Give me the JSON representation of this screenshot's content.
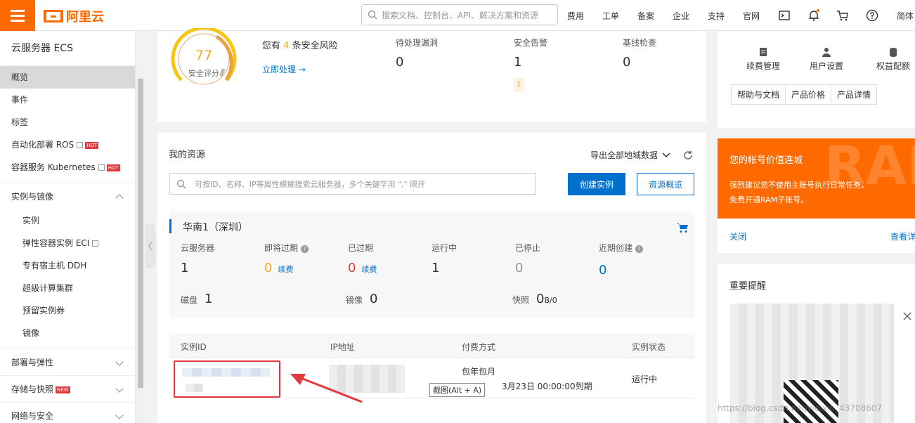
{
  "topbar": {
    "logo_text": "阿里云",
    "search_placeholder": "搜索文档、控制台、API、解决方案和资源",
    "nav_items": [
      "费用",
      "工单",
      "备案",
      "企业",
      "支持",
      "官网"
    ],
    "lang": "简体",
    "accent_color": "#ff6a00"
  },
  "sidebar": {
    "title": "云服务器 ECS",
    "items": [
      {
        "label": "概览"
      },
      {
        "label": "事件"
      },
      {
        "label": "标签"
      },
      {
        "label": "自动化部署 ROS",
        "badge": "HOT"
      },
      {
        "label": "容器服务 Kubernetes",
        "badge": "HOT"
      }
    ],
    "groups": [
      {
        "label": "实例与镜像",
        "children": [
          "实例",
          "弹性容器实例 ECI",
          "专有宿主机 DDH",
          "超级计算集群",
          "预留实例券",
          "镜像"
        ]
      },
      {
        "label": "部署与弹性"
      },
      {
        "label": "存储与快照",
        "badge": "NEW"
      },
      {
        "label": "网络与安全"
      }
    ]
  },
  "security": {
    "score": "77",
    "score_label": "安全评分",
    "risk_prefix": "您有",
    "risk_count": "4",
    "risk_suffix": "条安全风险",
    "action": "立即处理 →",
    "stats": [
      {
        "label": "待处理漏洞",
        "value": "0"
      },
      {
        "label": "安全告警",
        "value": "1",
        "tag": "1"
      },
      {
        "label": "基线检查",
        "value": "0"
      }
    ]
  },
  "resources": {
    "title": "我的资源",
    "export_label": "导出全部地域数据",
    "search_placeholder": "可按ID、名称、IP等属性模糊搜索云服务器，多个关键字用 \",\" 隔开",
    "create_button": "创建实例",
    "overview_button": "资源概览",
    "region": "华南1（深圳）",
    "stats": [
      {
        "label": "云服务器",
        "value": "1"
      },
      {
        "label": "即将过期",
        "value": "0",
        "action": "续费"
      },
      {
        "label": "已过期",
        "value": "0",
        "action": "续费"
      },
      {
        "label": "运行中",
        "value": "1"
      },
      {
        "label": "已停止",
        "value": "0"
      },
      {
        "label": "近期创建",
        "value": "0"
      }
    ],
    "storage": [
      {
        "label": "磁盘",
        "value": "1"
      },
      {
        "label": "镜像",
        "value": "0"
      },
      {
        "label": "快照",
        "value": "0",
        "unit": "B/0"
      }
    ],
    "table": {
      "columns": [
        "实例ID",
        "IP地址",
        "付费方式",
        "实例状态"
      ],
      "rows": [
        {
          "pay_type": "包年包月",
          "expiry": "3月23日 00:00:00到期",
          "status": "运行中"
        }
      ]
    },
    "tooltip": "截图(Alt + A)"
  },
  "right": {
    "quick_links": [
      "续费管理",
      "用户设置",
      "权益配额"
    ],
    "help_tabs": [
      "帮助与文档",
      "产品价格",
      "产品详情"
    ],
    "ram_banner": {
      "title": "您的帐号价值连城",
      "line1": "强烈建议您不使用主账号执行日常任务。",
      "line2": "免费开通RAM子账号。",
      "watermark": "RAM",
      "color": "#ff6a00"
    },
    "close_label": "关闭",
    "detail_label": "查看详",
    "notice_title": "重要提醒",
    "watermark": "https://blog.csdn.net/weixin_43708607"
  }
}
